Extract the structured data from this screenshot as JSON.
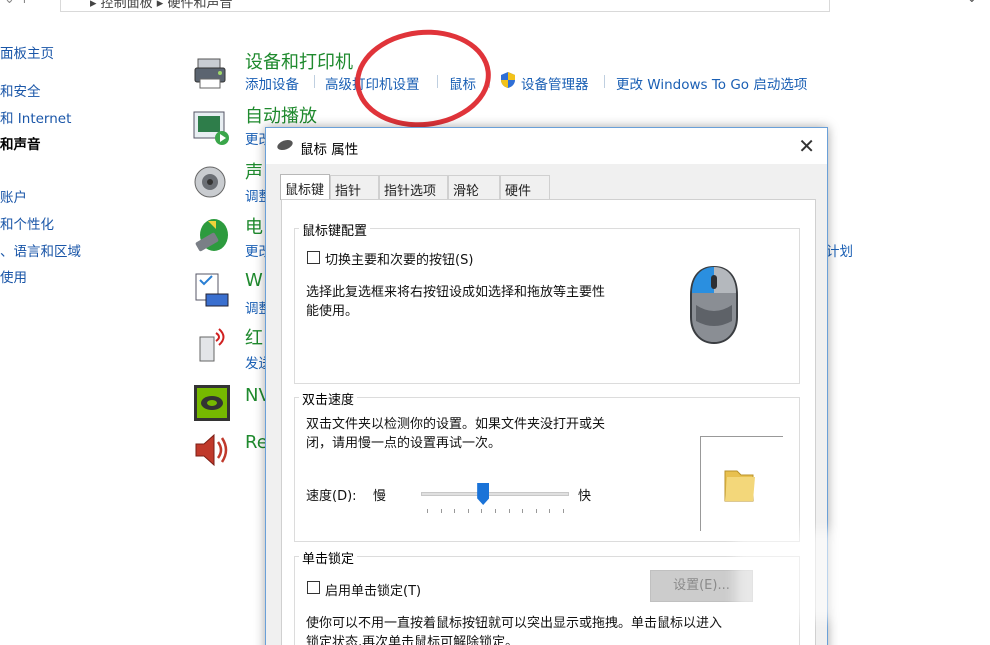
{
  "address": {
    "nav_back": "⌄  ↑",
    "crumb": "▸ 控制面板 ▸ 硬件和声音",
    "dropdown": "⌄"
  },
  "leftnav": {
    "items": [
      {
        "label": "面板主页"
      },
      {
        "label": "和安全"
      },
      {
        "label": "和 Internet"
      },
      {
        "label": "和声音"
      },
      {
        "label": "账户"
      },
      {
        "label": "和个性化"
      },
      {
        "label": "、语言和区域"
      },
      {
        "label": "使用"
      }
    ]
  },
  "categories": {
    "devices": {
      "title": "设备和打印机",
      "links": [
        "添加设备",
        "高级打印机设置",
        "鼠标",
        "设备管理器",
        "更改 Windows To Go 启动选项"
      ]
    },
    "autoplay": {
      "title": "自动播放",
      "link": "更改"
    },
    "sound": {
      "title": "声",
      "link": "调整"
    },
    "power": {
      "title": "电",
      "link": "更改",
      "right_fragment": "计划"
    },
    "windows_mobility": {
      "title": "W",
      "link": "调整"
    },
    "infrared": {
      "title": "红",
      "link": "发送"
    },
    "nvidia": {
      "title": "NV"
    },
    "realtek": {
      "title": "Re"
    }
  },
  "dialog": {
    "title": "鼠标 属性",
    "close": "✕",
    "tabs": [
      "鼠标键",
      "指针",
      "指针选项",
      "滑轮",
      "硬件"
    ],
    "button_config": {
      "label": "鼠标键配置",
      "checkbox": "切换主要和次要的按钮(S)",
      "desc_line1": "选择此复选框来将右按钮设成如选择和拖放等主要性",
      "desc_line2": "能使用。"
    },
    "dblclick": {
      "label": "双击速度",
      "desc_line1": "双击文件夹以检测你的设置。如果文件夹没打开或关",
      "desc_line2": "闭，请用慢一点的设置再试一次。",
      "speed_label": "速度(D):",
      "slow": "慢",
      "fast": "快",
      "speed_value": 0.42
    },
    "clicklock": {
      "label": "单击锁定",
      "checkbox": "启用单击锁定(T)",
      "settings_button": "设置(E)...",
      "desc_line1": "使你可以不用一直按着鼠标按钮就可以突出显示或拖拽。单击鼠标以进入",
      "desc_line2": "锁定状态,再次单击鼠标可解除锁定。"
    }
  },
  "colors": {
    "link": "#1a5fb4",
    "category_title": "#1f8a2e",
    "annotation": "#e0343a",
    "slider": "#1a73d8"
  }
}
